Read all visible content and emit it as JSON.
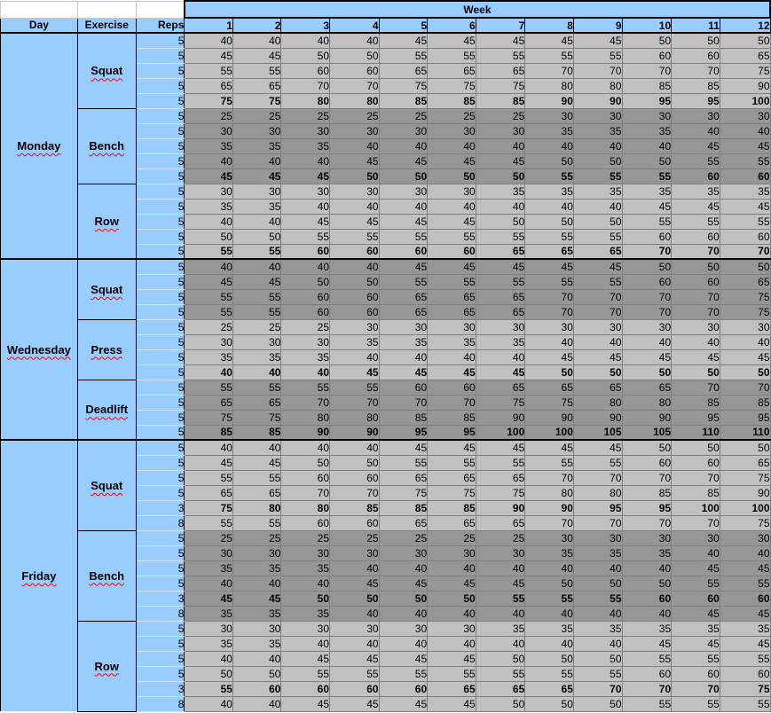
{
  "header": {
    "week_title": "Week",
    "day_label": "Day",
    "exercise_label": "Exercise",
    "reps_label": "Reps",
    "weeks": [
      "1",
      "2",
      "3",
      "4",
      "5",
      "6",
      "7",
      "8",
      "9",
      "10",
      "11",
      "12"
    ]
  },
  "colors": {
    "header_blue": "#99ccff",
    "light_cell": "#c0c0c0",
    "dark_cell": "#969696"
  },
  "days": [
    {
      "name": "Monday",
      "exercises": [
        {
          "name": "Squat",
          "shade": "light",
          "rows": [
            {
              "reps": "5",
              "bold": false,
              "values": [
                40,
                40,
                40,
                40,
                45,
                45,
                45,
                45,
                45,
                50,
                50,
                50
              ]
            },
            {
              "reps": "5",
              "bold": false,
              "values": [
                45,
                45,
                50,
                50,
                55,
                55,
                55,
                55,
                55,
                60,
                60,
                65
              ]
            },
            {
              "reps": "5",
              "bold": false,
              "values": [
                55,
                55,
                60,
                60,
                65,
                65,
                65,
                70,
                70,
                70,
                70,
                75
              ]
            },
            {
              "reps": "5",
              "bold": false,
              "values": [
                65,
                65,
                70,
                70,
                75,
                75,
                75,
                80,
                80,
                85,
                85,
                90
              ]
            },
            {
              "reps": "5",
              "bold": true,
              "values": [
                75,
                75,
                80,
                80,
                85,
                85,
                85,
                90,
                90,
                95,
                95,
                100
              ]
            }
          ]
        },
        {
          "name": "Bench",
          "shade": "dark",
          "rows": [
            {
              "reps": "5",
              "bold": false,
              "values": [
                25,
                25,
                25,
                25,
                25,
                25,
                25,
                30,
                30,
                30,
                30,
                30
              ]
            },
            {
              "reps": "5",
              "bold": false,
              "values": [
                30,
                30,
                30,
                30,
                30,
                30,
                30,
                35,
                35,
                35,
                40,
                40
              ]
            },
            {
              "reps": "5",
              "bold": false,
              "values": [
                35,
                35,
                35,
                40,
                40,
                40,
                40,
                40,
                40,
                40,
                45,
                45
              ]
            },
            {
              "reps": "5",
              "bold": false,
              "values": [
                40,
                40,
                40,
                45,
                45,
                45,
                45,
                50,
                50,
                50,
                55,
                55
              ]
            },
            {
              "reps": "5",
              "bold": true,
              "values": [
                45,
                45,
                45,
                50,
                50,
                50,
                50,
                55,
                55,
                55,
                60,
                60
              ]
            }
          ]
        },
        {
          "name": "Row",
          "shade": "light",
          "rows": [
            {
              "reps": "5",
              "bold": false,
              "values": [
                30,
                30,
                30,
                30,
                30,
                30,
                35,
                35,
                35,
                35,
                35,
                35
              ]
            },
            {
              "reps": "5",
              "bold": false,
              "values": [
                35,
                35,
                40,
                40,
                40,
                40,
                40,
                40,
                40,
                45,
                45,
                45
              ]
            },
            {
              "reps": "5",
              "bold": false,
              "values": [
                40,
                40,
                45,
                45,
                45,
                45,
                50,
                50,
                50,
                55,
                55,
                55
              ]
            },
            {
              "reps": "5",
              "bold": false,
              "values": [
                50,
                50,
                55,
                55,
                55,
                55,
                55,
                55,
                55,
                60,
                60,
                60
              ]
            },
            {
              "reps": "5",
              "bold": true,
              "values": [
                55,
                55,
                60,
                60,
                60,
                60,
                65,
                65,
                65,
                70,
                70,
                70
              ]
            }
          ]
        }
      ]
    },
    {
      "name": "Wednesday",
      "exercises": [
        {
          "name": "Squat",
          "shade": "dark",
          "rows": [
            {
              "reps": "5",
              "bold": false,
              "values": [
                40,
                40,
                40,
                40,
                45,
                45,
                45,
                45,
                45,
                50,
                50,
                50
              ]
            },
            {
              "reps": "5",
              "bold": false,
              "values": [
                45,
                45,
                50,
                50,
                55,
                55,
                55,
                55,
                55,
                60,
                60,
                65
              ]
            },
            {
              "reps": "5",
              "bold": false,
              "values": [
                55,
                55,
                60,
                60,
                65,
                65,
                65,
                70,
                70,
                70,
                70,
                75
              ]
            },
            {
              "reps": "5",
              "bold": false,
              "values": [
                55,
                55,
                60,
                60,
                65,
                65,
                65,
                70,
                70,
                70,
                70,
                75
              ]
            }
          ]
        },
        {
          "name": "Press",
          "shade": "light",
          "rows": [
            {
              "reps": "5",
              "bold": false,
              "values": [
                25,
                25,
                25,
                30,
                30,
                30,
                30,
                30,
                30,
                30,
                30,
                30
              ]
            },
            {
              "reps": "5",
              "bold": false,
              "values": [
                30,
                30,
                30,
                35,
                35,
                35,
                35,
                40,
                40,
                40,
                40,
                40
              ]
            },
            {
              "reps": "5",
              "bold": false,
              "values": [
                35,
                35,
                35,
                40,
                40,
                40,
                40,
                45,
                45,
                45,
                45,
                45
              ]
            },
            {
              "reps": "5",
              "bold": true,
              "values": [
                40,
                40,
                40,
                45,
                45,
                45,
                45,
                50,
                50,
                50,
                50,
                50
              ]
            }
          ]
        },
        {
          "name": "Deadlift",
          "shade": "dark",
          "rows": [
            {
              "reps": "5",
              "bold": false,
              "values": [
                55,
                55,
                55,
                55,
                60,
                60,
                65,
                65,
                65,
                65,
                70,
                70
              ]
            },
            {
              "reps": "5",
              "bold": false,
              "values": [
                65,
                65,
                70,
                70,
                70,
                70,
                75,
                75,
                80,
                80,
                85,
                85
              ]
            },
            {
              "reps": "5",
              "bold": false,
              "values": [
                75,
                75,
                80,
                80,
                85,
                85,
                90,
                90,
                90,
                90,
                95,
                95
              ]
            },
            {
              "reps": "5",
              "bold": true,
              "values": [
                85,
                85,
                90,
                90,
                95,
                95,
                100,
                100,
                105,
                105,
                110,
                110
              ]
            }
          ]
        }
      ]
    },
    {
      "name": "Friday",
      "exercises": [
        {
          "name": "Squat",
          "shade": "light",
          "rows": [
            {
              "reps": "5",
              "bold": false,
              "values": [
                40,
                40,
                40,
                40,
                45,
                45,
                45,
                45,
                45,
                50,
                50,
                50
              ]
            },
            {
              "reps": "5",
              "bold": false,
              "values": [
                45,
                45,
                50,
                50,
                55,
                55,
                55,
                55,
                55,
                60,
                60,
                65
              ]
            },
            {
              "reps": "5",
              "bold": false,
              "values": [
                55,
                55,
                60,
                60,
                65,
                65,
                65,
                70,
                70,
                70,
                70,
                75
              ]
            },
            {
              "reps": "5",
              "bold": false,
              "values": [
                65,
                65,
                70,
                70,
                75,
                75,
                75,
                80,
                80,
                85,
                85,
                90
              ]
            },
            {
              "reps": "3",
              "bold": true,
              "values": [
                75,
                80,
                80,
                85,
                85,
                85,
                90,
                90,
                95,
                95,
                100,
                100
              ]
            },
            {
              "reps": "8",
              "bold": false,
              "values": [
                55,
                55,
                60,
                60,
                65,
                65,
                65,
                70,
                70,
                70,
                70,
                75
              ]
            }
          ]
        },
        {
          "name": "Bench",
          "shade": "dark",
          "rows": [
            {
              "reps": "5",
              "bold": false,
              "values": [
                25,
                25,
                25,
                25,
                25,
                25,
                25,
                30,
                30,
                30,
                30,
                30
              ]
            },
            {
              "reps": "5",
              "bold": false,
              "values": [
                30,
                30,
                30,
                30,
                30,
                30,
                30,
                35,
                35,
                35,
                40,
                40
              ]
            },
            {
              "reps": "5",
              "bold": false,
              "values": [
                35,
                35,
                35,
                40,
                40,
                40,
                40,
                40,
                40,
                40,
                45,
                45
              ]
            },
            {
              "reps": "5",
              "bold": false,
              "values": [
                40,
                40,
                40,
                45,
                45,
                45,
                45,
                50,
                50,
                50,
                55,
                55
              ]
            },
            {
              "reps": "3",
              "bold": true,
              "values": [
                45,
                45,
                50,
                50,
                50,
                50,
                55,
                55,
                55,
                60,
                60,
                60
              ]
            },
            {
              "reps": "8",
              "bold": false,
              "values": [
                35,
                35,
                35,
                40,
                40,
                40,
                40,
                40,
                40,
                40,
                45,
                45
              ]
            }
          ]
        },
        {
          "name": "Row",
          "shade": "light",
          "rows": [
            {
              "reps": "5",
              "bold": false,
              "values": [
                30,
                30,
                30,
                30,
                30,
                30,
                35,
                35,
                35,
                35,
                35,
                35
              ]
            },
            {
              "reps": "5",
              "bold": false,
              "values": [
                35,
                35,
                40,
                40,
                40,
                40,
                40,
                40,
                40,
                45,
                45,
                45
              ]
            },
            {
              "reps": "5",
              "bold": false,
              "values": [
                40,
                40,
                45,
                45,
                45,
                45,
                50,
                50,
                50,
                55,
                55,
                55
              ]
            },
            {
              "reps": "5",
              "bold": false,
              "values": [
                50,
                50,
                55,
                55,
                55,
                55,
                55,
                55,
                55,
                60,
                60,
                60
              ]
            },
            {
              "reps": "3",
              "bold": true,
              "values": [
                55,
                60,
                60,
                60,
                60,
                65,
                65,
                65,
                70,
                70,
                70,
                75
              ]
            },
            {
              "reps": "8",
              "bold": false,
              "values": [
                40,
                40,
                45,
                45,
                45,
                45,
                50,
                50,
                50,
                55,
                55,
                55
              ]
            }
          ]
        }
      ]
    }
  ]
}
